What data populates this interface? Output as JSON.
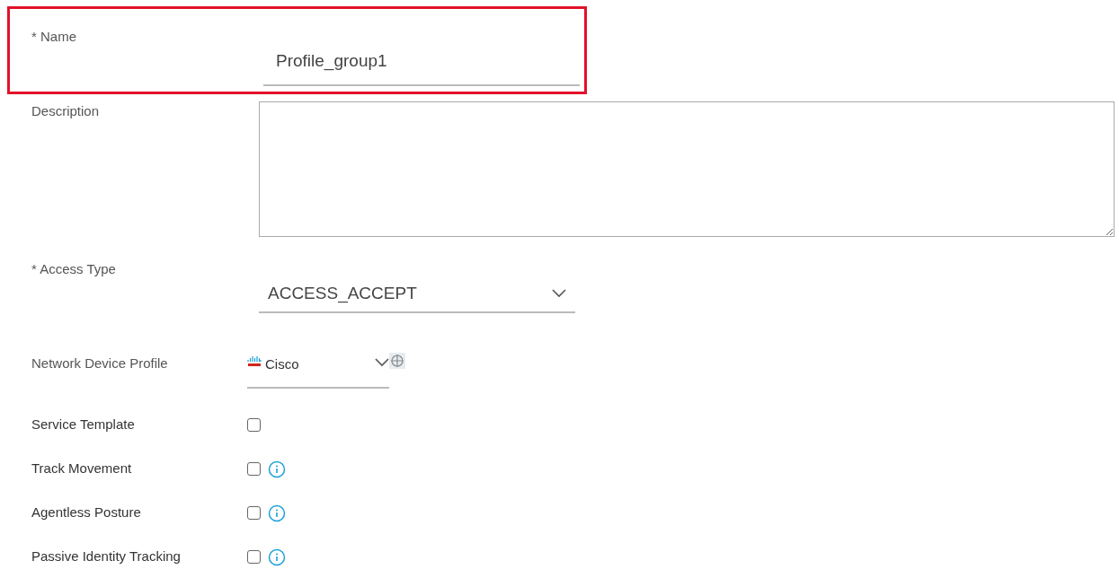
{
  "name_field": {
    "label": "* Name",
    "value": "Profile_group1",
    "highlighted": true
  },
  "description": {
    "label": "Description"
  },
  "access_type": {
    "label": "* Access Type",
    "value": "ACCESS_ACCEPT"
  },
  "network_device_profile": {
    "label": "Network Device Profile",
    "value": "Cisco"
  },
  "options": [
    {
      "label": "Service Template",
      "checked": false,
      "info": false
    },
    {
      "label": "Track Movement",
      "checked": false,
      "info": true
    },
    {
      "label": "Agentless Posture",
      "checked": false,
      "info": true
    },
    {
      "label": "Passive Identity Tracking",
      "checked": false,
      "info": true
    }
  ]
}
